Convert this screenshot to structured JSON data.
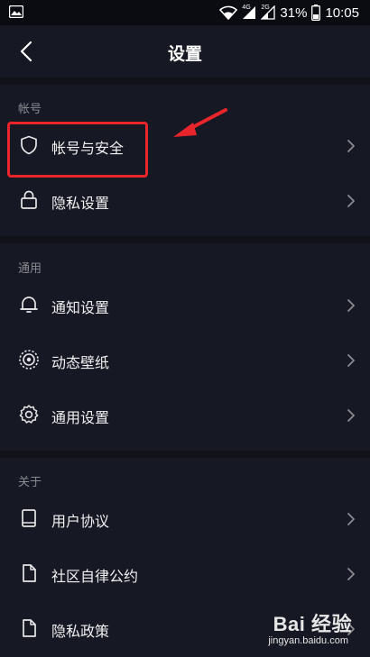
{
  "status_bar": {
    "battery": "31%",
    "time": "10:05",
    "network_1": "4G",
    "network_2": "2G"
  },
  "header": {
    "title": "设置"
  },
  "sections": {
    "account": {
      "label": "帐号",
      "items": [
        {
          "label": "帐号与安全",
          "icon": "shield-icon"
        },
        {
          "label": "隐私设置",
          "icon": "lock-icon"
        }
      ]
    },
    "general": {
      "label": "通用",
      "items": [
        {
          "label": "通知设置",
          "icon": "bell-icon"
        },
        {
          "label": "动态壁纸",
          "icon": "live-wallpaper-icon"
        },
        {
          "label": "通用设置",
          "icon": "gear-icon"
        }
      ]
    },
    "about": {
      "label": "关于",
      "items": [
        {
          "label": "用户协议",
          "icon": "book-icon"
        },
        {
          "label": "社区自律公约",
          "icon": "document-icon"
        },
        {
          "label": "隐私政策",
          "icon": "document-icon"
        }
      ]
    }
  },
  "annotation": {
    "highlight_color": "#e8252b"
  },
  "watermark": {
    "logo_text": "Bai 经验",
    "url": "jingyan.baidu.com"
  },
  "colors": {
    "background": "#161823",
    "text": "#f0f0f2",
    "section_label": "#8a8b91"
  }
}
